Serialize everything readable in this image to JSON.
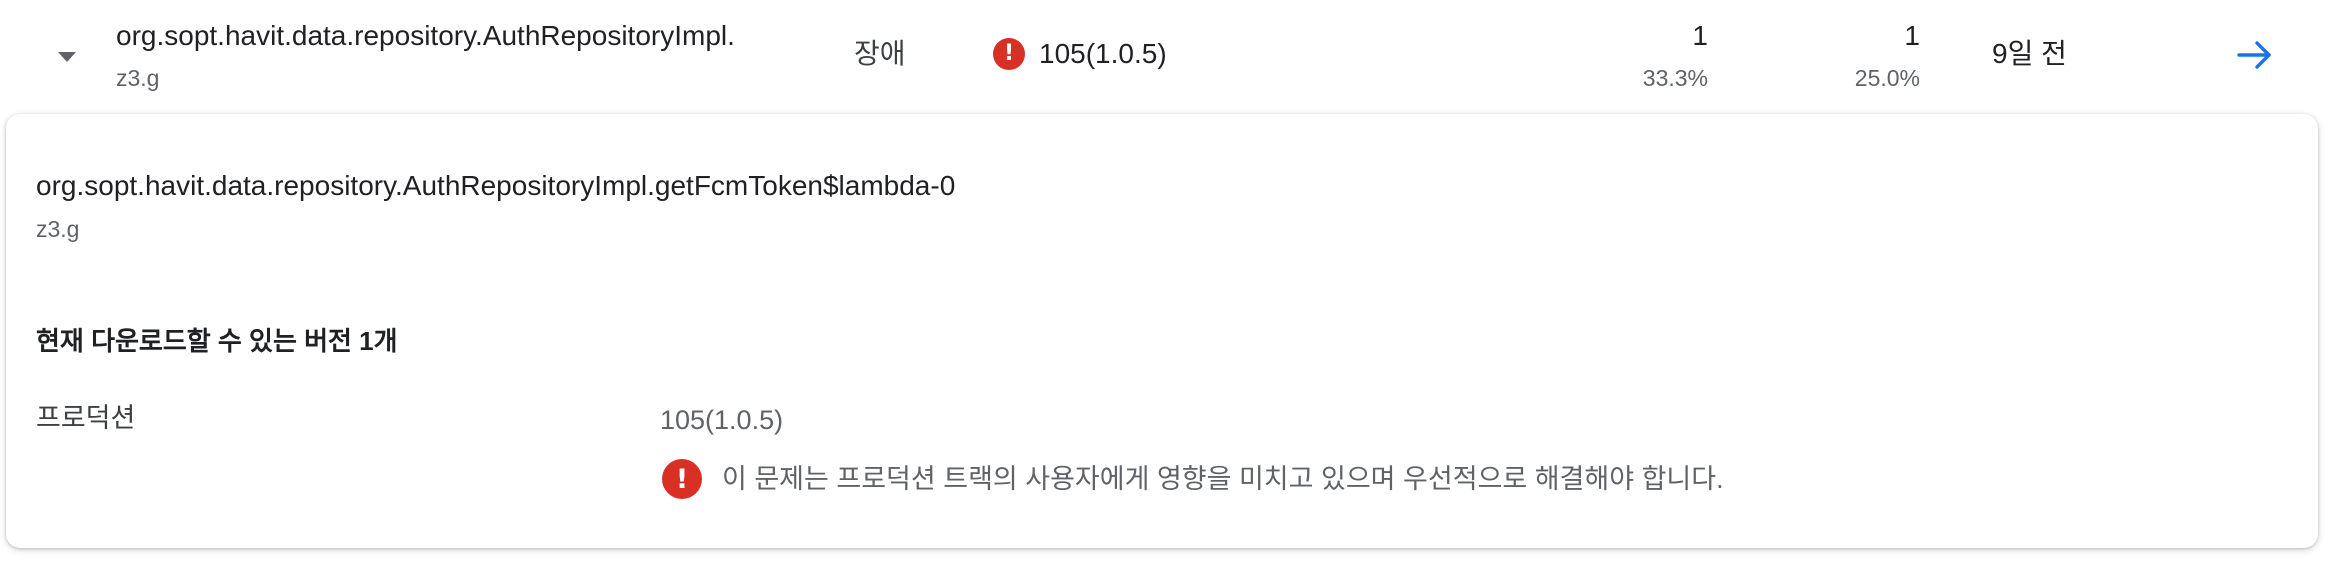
{
  "issue_row": {
    "title": "org.sopt.havit.data.repository.AuthRepositoryImpl.",
    "subtitle": "z3.g",
    "type": "장애",
    "version": "105(1.0.5)",
    "events": {
      "count": "1",
      "percent": "33.3%"
    },
    "users": {
      "count": "1",
      "percent": "25.0%"
    },
    "age": "9일 전",
    "icons": {
      "expand": "chevron-down-icon",
      "status": "error-icon",
      "open": "arrow-right-icon"
    },
    "colors": {
      "error": "#d93025",
      "link": "#1a73e8"
    }
  },
  "detail_card": {
    "title": "org.sopt.havit.data.repository.AuthRepositoryImpl.getFcmToken$lambda-0",
    "subtitle": "z3.g",
    "versions_heading": "현재 다운로드할 수 있는 버전 1개",
    "track": {
      "name": "프로덕션",
      "version": "105(1.0.5)",
      "warning": "이 문제는 프로덕션 트랙의 사용자에게 영향을 미치고 있으며 우선적으로 해결해야 합니다."
    }
  }
}
